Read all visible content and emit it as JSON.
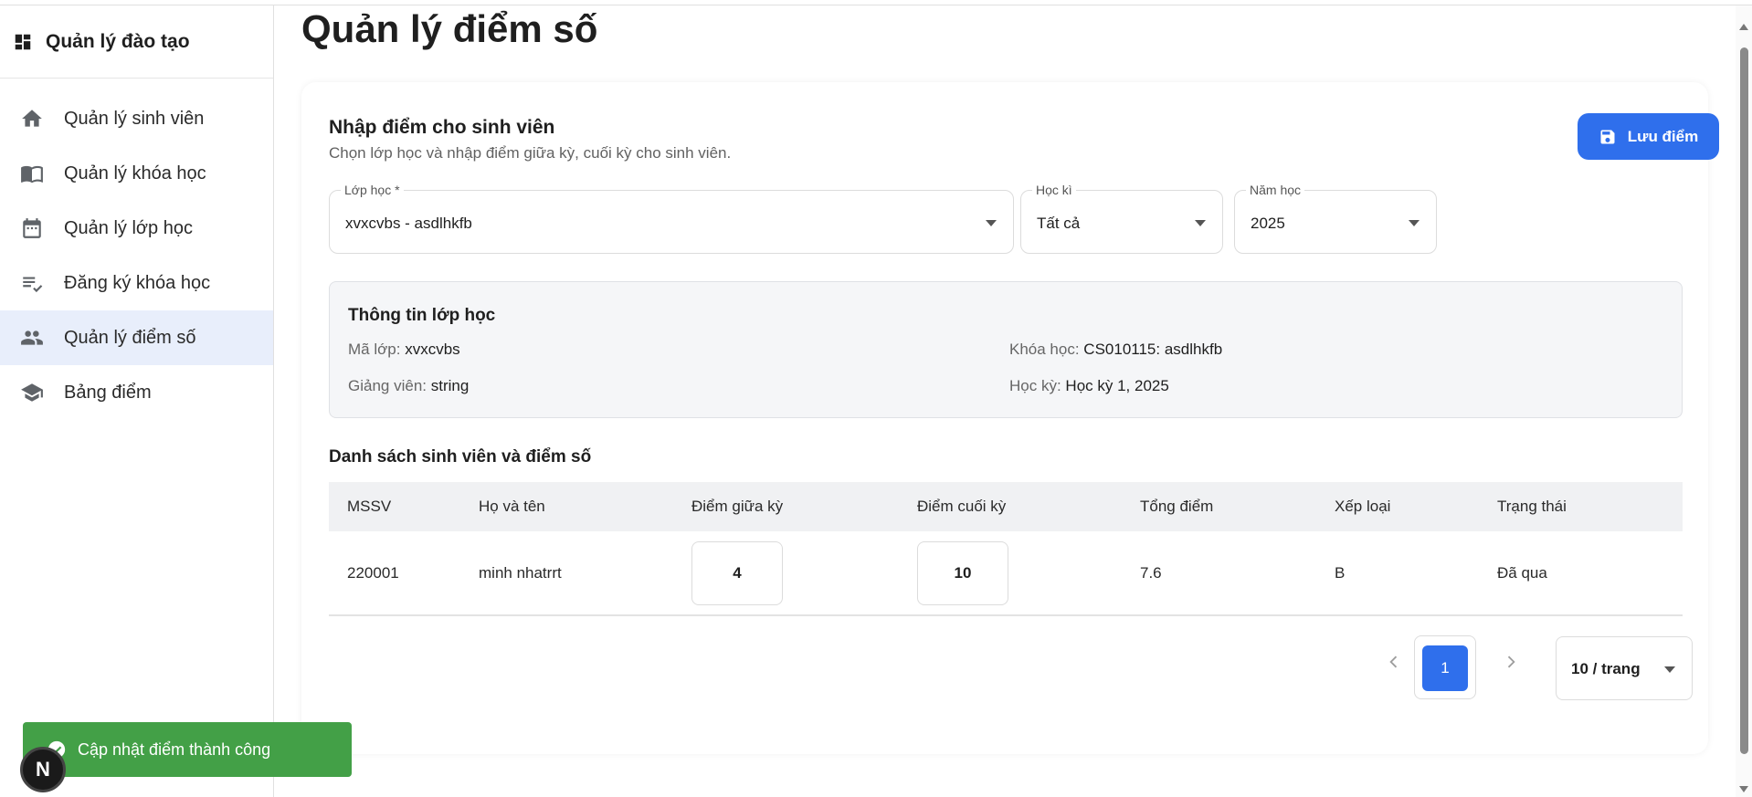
{
  "app": {
    "title": "Quản lý đào tạo"
  },
  "sidebar": {
    "items": [
      {
        "label": "Quản lý sinh viên",
        "icon": "home-icon"
      },
      {
        "label": "Quản lý khóa học",
        "icon": "book-icon"
      },
      {
        "label": "Quản lý lớp học",
        "icon": "calendar-icon"
      },
      {
        "label": "Đăng ký khóa học",
        "icon": "checklist-icon"
      },
      {
        "label": "Quản lý điểm số",
        "icon": "people-icon",
        "active": true
      },
      {
        "label": "Bảng điểm",
        "icon": "school-icon"
      }
    ]
  },
  "page": {
    "title": "Quản lý điểm số"
  },
  "card": {
    "title": "Nhập điểm cho sinh viên",
    "subtitle": "Chọn lớp học và nhập điểm giữa kỳ, cuối kỳ cho sinh viên.",
    "save_label": "Lưu điểm"
  },
  "filters": {
    "class": {
      "label": "Lớp học *",
      "value": "xvxcvbs - asdlhkfb"
    },
    "semester": {
      "label": "Học kì",
      "value": "Tất cả"
    },
    "year": {
      "label": "Năm học",
      "value": "2025"
    }
  },
  "class_info": {
    "title": "Thông tin lớp học",
    "code_label": "Mã lớp:",
    "code_value": "xvxcvbs",
    "course_label": "Khóa học:",
    "course_value": "CS010115: asdlhkfb",
    "lecturer_label": "Giảng viên:",
    "lecturer_value": "string",
    "term_label": "Học kỳ:",
    "term_value": "Học kỳ 1, 2025"
  },
  "students": {
    "title": "Danh sách sinh viên và điểm số",
    "columns": [
      "MSSV",
      "Họ và tên",
      "Điểm giữa kỳ",
      "Điểm cuối kỳ",
      "Tổng điểm",
      "Xếp loại",
      "Trạng thái"
    ],
    "rows": [
      {
        "id": "220001",
        "name": "minh nhatrrt",
        "midterm": "4",
        "final": "10",
        "total": "7.6",
        "grade": "B",
        "status": "Đã qua"
      }
    ]
  },
  "pagination": {
    "current_page": "1",
    "page_size": "10 / trang"
  },
  "toast": {
    "message": "Cập nhật điểm thành công"
  },
  "badge": {
    "letter": "N"
  },
  "colors": {
    "primary": "#2f6fec",
    "toast": "#43a047",
    "active_nav": "#e8eefb"
  }
}
